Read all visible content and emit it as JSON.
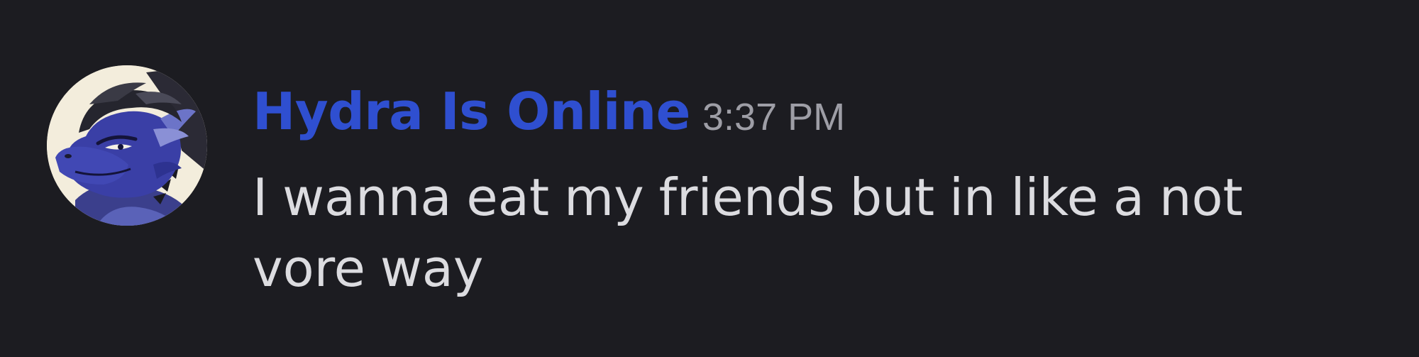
{
  "message": {
    "author": {
      "name": "Hydra Is Online",
      "name_color": "#2f4fd0",
      "avatar_icon": "blue-dragon-avatar"
    },
    "timestamp": "3:37 PM",
    "content": "I wanna eat my friends but in like a not vore way"
  },
  "colors": {
    "background": "#1c1c21",
    "text": "#dcdce0",
    "timestamp": "#9e9ea6"
  }
}
